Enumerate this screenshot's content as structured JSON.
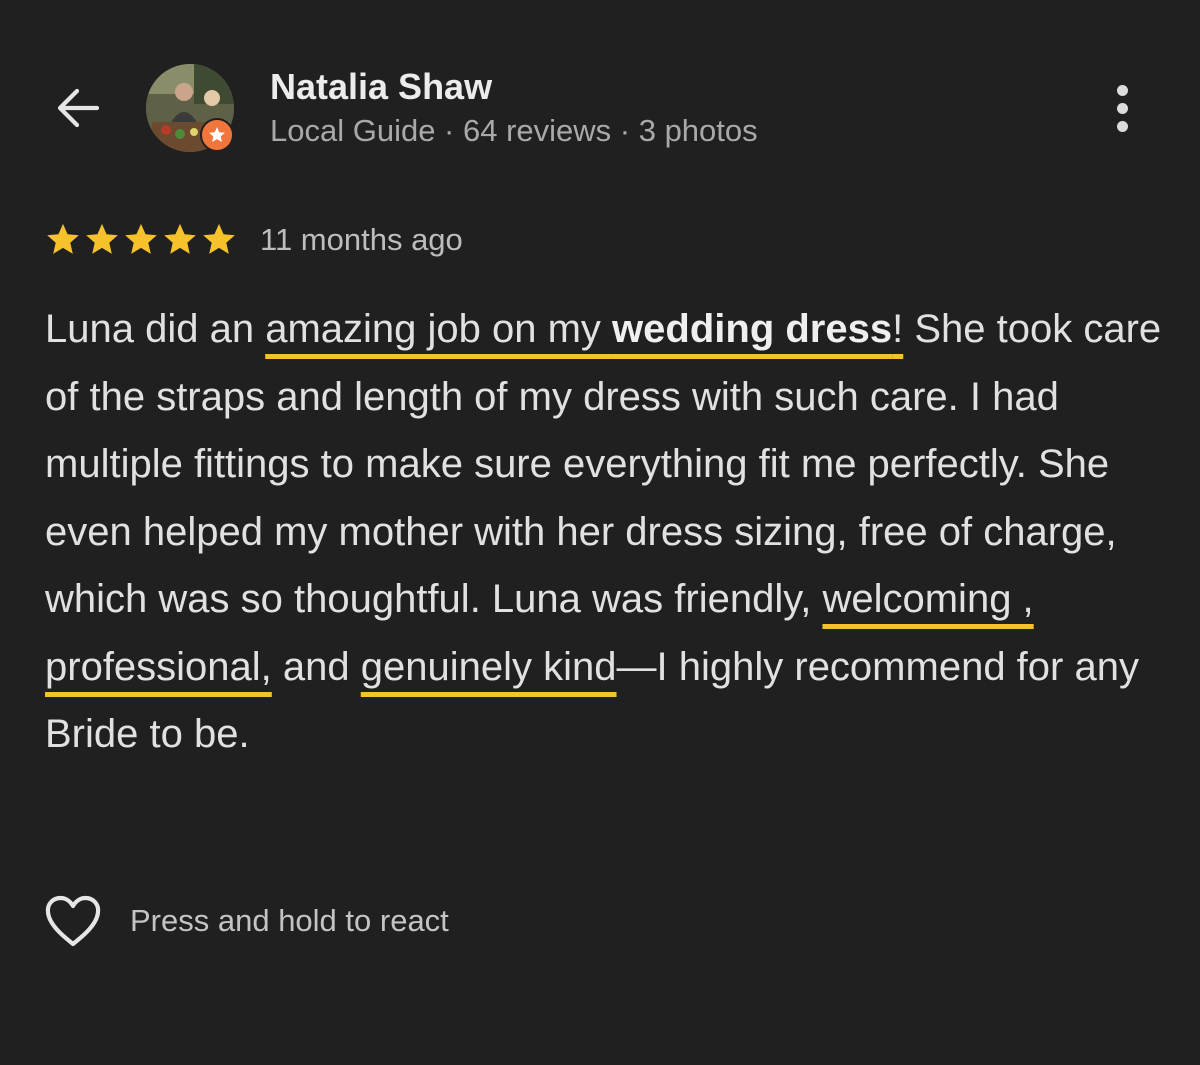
{
  "header": {
    "back_icon": "arrow-left-icon",
    "user_name": "Natalia Shaw",
    "user_meta": "Local Guide · 64 reviews · 3 photos",
    "badge_icon": "local-guide-star-icon",
    "more_icon": "more-vertical-icon"
  },
  "review": {
    "rating": 5,
    "rating_max": 5,
    "time_ago": "11 months ago",
    "segments": [
      {
        "text": "Luna did an ",
        "bold": false,
        "underline": false
      },
      {
        "text": "amazing job on my ",
        "bold": false,
        "underline": true
      },
      {
        "text": "wedding dress",
        "bold": true,
        "underline": true
      },
      {
        "text": "!",
        "bold": false,
        "underline": true
      },
      {
        "text": " She took care of the straps and length of my dress with such care. I had multiple fittings to make sure everything fit me perfectly. She even helped my mother with her dress sizing, free of charge, which was so thoughtful. Luna was friendly, ",
        "bold": false,
        "underline": false
      },
      {
        "text": "welcoming , professional,",
        "bold": false,
        "underline": true
      },
      {
        "text": " and ",
        "bold": false,
        "underline": false
      },
      {
        "text": "genuinely kind",
        "bold": false,
        "underline": true
      },
      {
        "text": "—I highly recommend for any Bride to be.",
        "bold": false,
        "underline": false
      }
    ]
  },
  "react": {
    "icon": "heart-outline-icon",
    "label": "Press and hold to react"
  },
  "colors": {
    "background": "#202020",
    "star": "#f6c22b",
    "underline": "#f6c22b",
    "badge": "#f0763b"
  }
}
